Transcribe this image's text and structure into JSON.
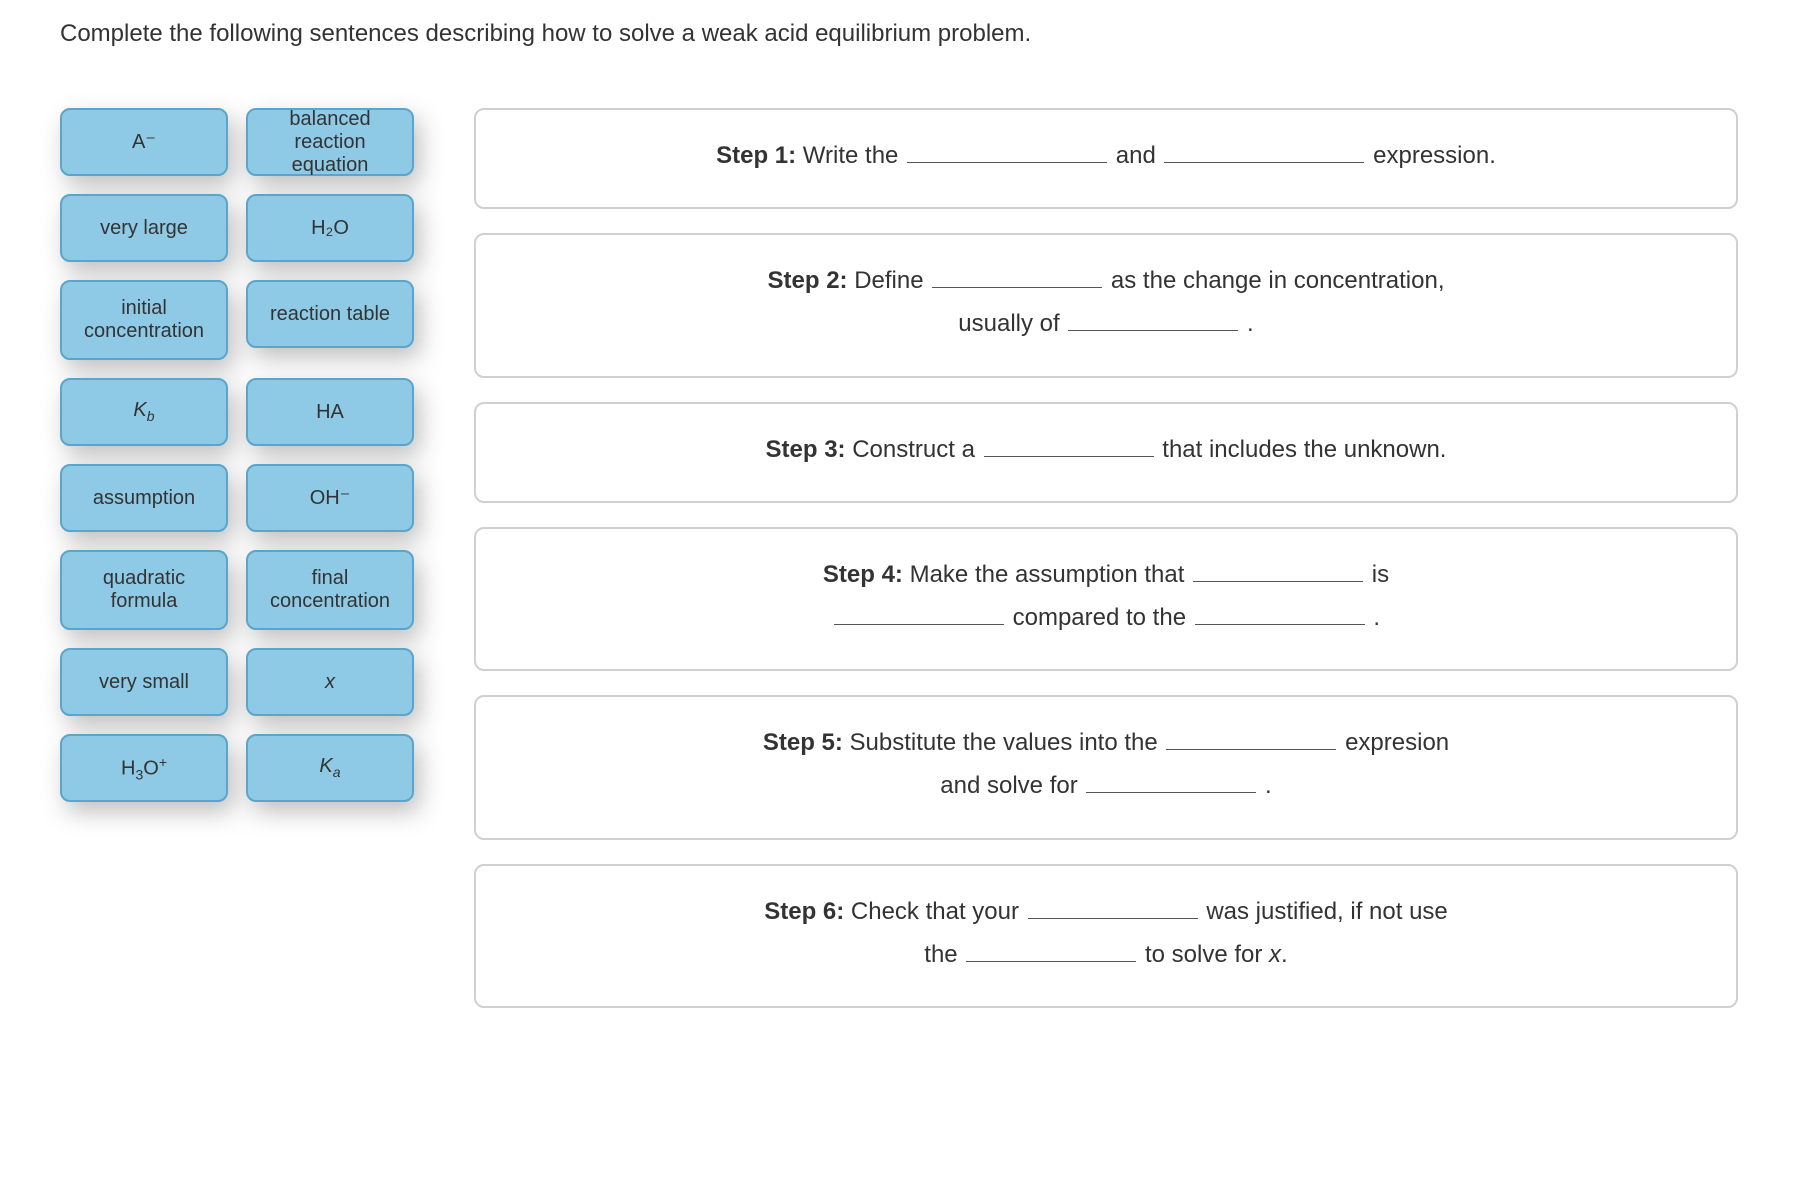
{
  "prompt": "Complete the following sentences describing how to solve a weak acid equilibrium problem.",
  "tiles": {
    "a_minus": "A⁻",
    "balanced": "balanced reaction equation",
    "very_large": "very large",
    "h2o": "H₂O",
    "initial_conc": "initial concentration",
    "reaction_table": "reaction table",
    "kb_pre": "K",
    "kb_sub": "b",
    "ha": "HA",
    "assumption": "assumption",
    "oh_minus": "OH⁻",
    "quadratic": "quadratic formula",
    "final_conc": "final concentration",
    "very_small": "very small",
    "x": "x",
    "h3o_pre": "H",
    "h3o_sub1": "3",
    "h3o_mid": "O",
    "h3o_sup": "+",
    "ka_pre": "K",
    "ka_sub": "a"
  },
  "steps": {
    "s1": {
      "label": "Step 1:",
      "t1": " Write the ",
      "t2": " and ",
      "t3": " expression."
    },
    "s2": {
      "label": "Step 2:",
      "t1": " Define ",
      "t2": " as the change in concentration,",
      "t3": "usually of ",
      "t4": " ."
    },
    "s3": {
      "label": "Step 3:",
      "t1": " Construct a ",
      "t2": " that includes the unknown."
    },
    "s4": {
      "label": "Step 4:",
      "t1": " Make the assumption that ",
      "t2": " is",
      "t3": " compared to the ",
      "t4": " ."
    },
    "s5": {
      "label": "Step 5:",
      "t1": " Substitute the values into the ",
      "t2": " expresion",
      "t3": "and solve for ",
      "t4": " ."
    },
    "s6": {
      "label": "Step 6:",
      "t1": " Check that your ",
      "t2": " was justified, if not use",
      "t3": "the ",
      "t4": " to solve for ",
      "t5": "x",
      "t6": "."
    }
  }
}
